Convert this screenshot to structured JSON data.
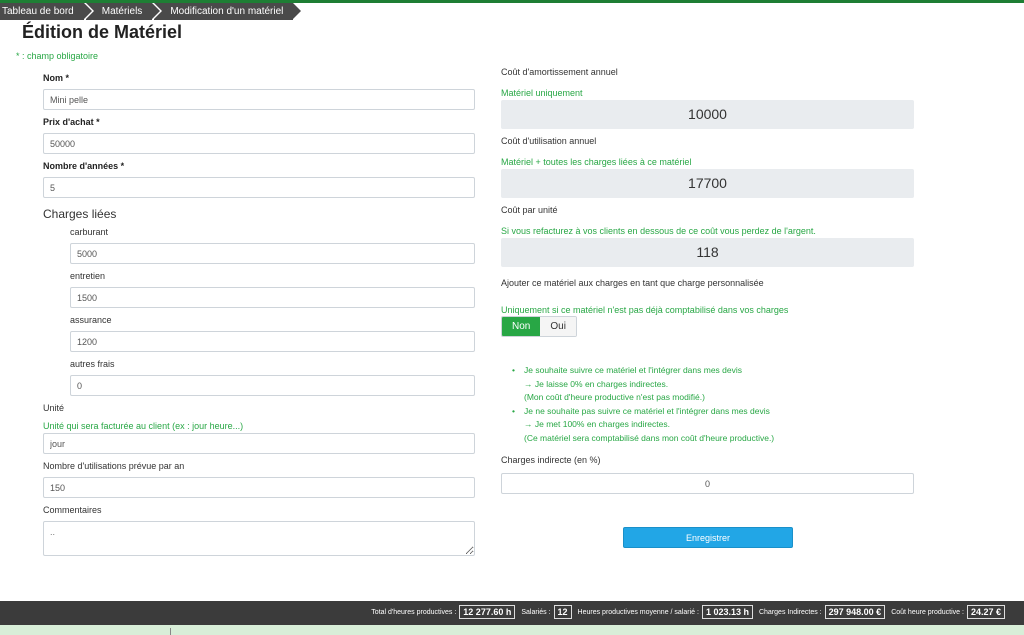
{
  "breadcrumb": [
    "Tableau de bord",
    "Matériels",
    "Modification d'un matériel"
  ],
  "page_title": "Édition de Matériel",
  "required_note": "* : champ obligatoire",
  "left": {
    "nom_label": "Nom *",
    "nom_value": "Mini pelle",
    "prix_label": "Prix d'achat *",
    "prix_value": "50000",
    "annees_label": "Nombre d'années *",
    "annees_value": "5",
    "charges_title": "Charges liées",
    "charges": [
      {
        "label": "carburant",
        "value": "5000"
      },
      {
        "label": "entretien",
        "value": "1500"
      },
      {
        "label": "assurance",
        "value": "1200"
      },
      {
        "label": "autres frais",
        "value": "0"
      }
    ],
    "unite_label": "Unité",
    "unite_hint": "Unité qui sera facturée au client (ex : jour heure...)",
    "unite_value": "jour",
    "nb_util_label": "Nombre d'utilisations prévue par an",
    "nb_util_value": "150",
    "comment_label": "Commentaires",
    "comment_placeholder": ".."
  },
  "right": {
    "amort_label": "Coût d'amortissement annuel",
    "amort_hint": "Matériel uniquement",
    "amort_value": "10000",
    "util_label": "Coût d'utilisation annuel",
    "util_hint": "Matériel + toutes les charges liées à ce matériel",
    "util_value": "17700",
    "unit_label": "Coût par unité",
    "unit_hint": "Si vous refacturez à vos clients en dessous de ce coût vous perdez de l'argent.",
    "unit_value": "118",
    "add_label": "Ajouter ce matériel aux charges en tant que charge personnalisée",
    "add_hint": "Uniquement si ce matériel n'est pas déjà comptabilisé dans vos charges",
    "toggle_on": "Non",
    "toggle_off": "Oui",
    "info1_main": "Je souhaite suivre ce matériel et l'intégrer dans mes devis",
    "info1_sub1": "→ Je laisse 0% en charges indirectes.",
    "info1_sub2": "(Mon coût d'heure productive n'est pas modifié.)",
    "info2_main": "Je ne souhaite pas suivre ce matériel et l'intégrer dans mes devis",
    "info2_sub1": "→ Je met 100% en charges indirectes.",
    "info2_sub2": "(Ce matériel sera comptabilisé dans mon coût d'heure productive.)",
    "indirect_label": "Charges indirecte (en %)",
    "indirect_value": "0",
    "save_label": "Enregistrer"
  },
  "footer": {
    "total_heures_label": "Total d'heures productives :",
    "total_heures_value": "12 277.60 h",
    "salaries_label": "Salariés :",
    "salaries_value": "12",
    "heures_moy_label": "Heures productives moyenne / salarié :",
    "heures_moy_value": "1 023.13 h",
    "charges_ind_label": "Charges Indirectes :",
    "charges_ind_value": "297 948.00 €",
    "cout_heure_label": "Coût heure productive :",
    "cout_heure_value": "24.27 €"
  }
}
